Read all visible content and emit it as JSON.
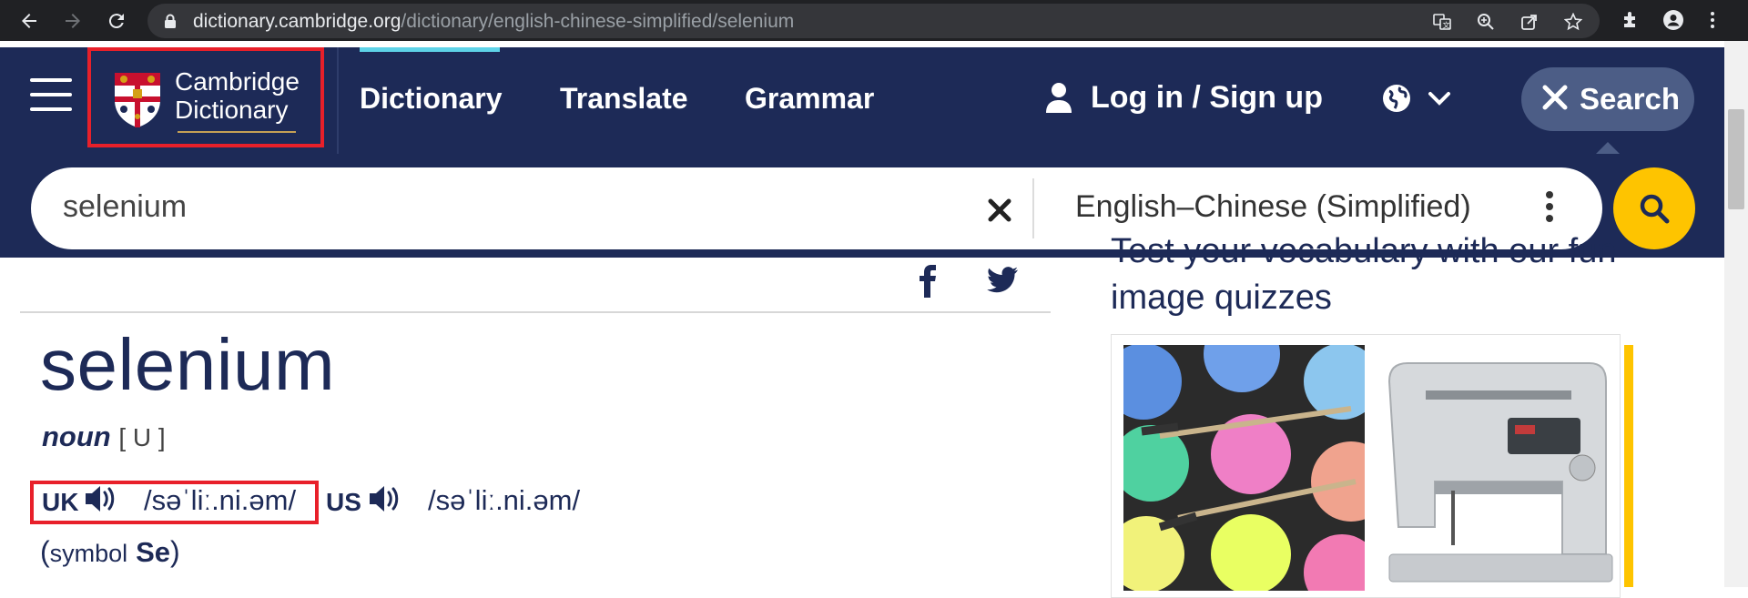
{
  "browser": {
    "url_host": "dictionary.cambridge.org",
    "url_path": "/dictionary/english-chinese-simplified/selenium"
  },
  "header": {
    "logo_line1": "Cambridge",
    "logo_line2": "Dictionary",
    "nav": [
      "Dictionary",
      "Translate",
      "Grammar"
    ],
    "login_label": "Log in",
    "login_sep": " / ",
    "signup_label": "Sign up",
    "search_pill_label": "Search"
  },
  "search": {
    "query": "selenium",
    "language": "English–Chinese (Simplified)"
  },
  "entry": {
    "headword": "selenium",
    "pos": "noun",
    "grammar": "[ U ]",
    "uk_label": "UK",
    "uk_ipa": "/səˈliː.ni.əm/",
    "us_label": "US",
    "us_ipa": "/səˈliː.ni.əm/",
    "symbol_open": "(",
    "symbol_word": "symbol",
    "symbol_value": "Se",
    "symbol_close": ")"
  },
  "sidebar": {
    "quiz_title": "Test your vocabulary with our fun image quizzes"
  },
  "colors": {
    "navy": "#1d2a57",
    "accent_yellow": "#fec400",
    "highlight_red": "#e8202a",
    "active_cyan": "#5ed3e8"
  }
}
